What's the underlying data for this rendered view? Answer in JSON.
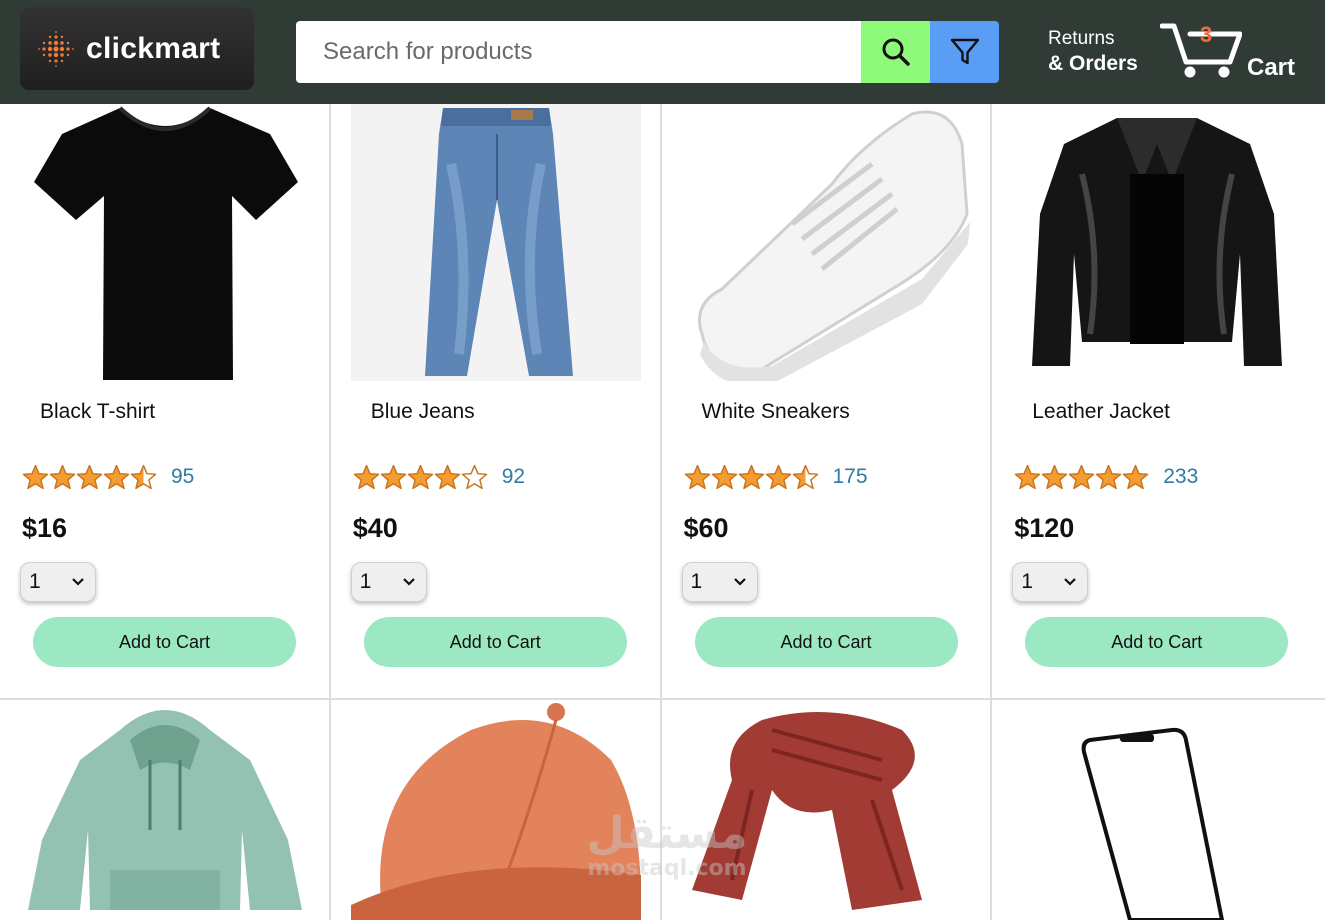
{
  "header": {
    "logo_text": "clickmart",
    "search_placeholder": "Search for products",
    "returns_line1": "Returns",
    "returns_line2": "& Orders",
    "cart_count": "3",
    "cart_label": "Cart",
    "colors": {
      "header_bg": "#2f3b34",
      "search_button": "#8dfa7a",
      "filter_button": "#5a9df5",
      "cart_count": "#f26b3a"
    }
  },
  "products": [
    {
      "name": "Black T-shirt",
      "rating": 4.5,
      "rating_count": "95",
      "price": "$16",
      "quantity": "1",
      "add_label": "Add to Cart",
      "image": "tshirt-icon"
    },
    {
      "name": "Blue Jeans",
      "rating": 4.0,
      "rating_count": "92",
      "price": "$40",
      "quantity": "1",
      "add_label": "Add to Cart",
      "image": "jeans-icon"
    },
    {
      "name": "White Sneakers",
      "rating": 4.5,
      "rating_count": "175",
      "price": "$60",
      "quantity": "1",
      "add_label": "Add to Cart",
      "image": "sneaker-icon"
    },
    {
      "name": "Leather Jacket",
      "rating": 5.0,
      "rating_count": "233",
      "price": "$120",
      "quantity": "1",
      "add_label": "Add to Cart",
      "image": "jacket-icon"
    }
  ],
  "products_row2": [
    {
      "image": "hoodie-icon"
    },
    {
      "image": "cap-icon"
    },
    {
      "image": "scarf-icon"
    },
    {
      "image": "phone-icon"
    }
  ],
  "watermark": {
    "arabic": "مستقل",
    "latin": "mostaql.com"
  },
  "colors": {
    "star": "#f39c32",
    "rating_count": "#2e7ca3",
    "add_button": "#9be8c3"
  }
}
